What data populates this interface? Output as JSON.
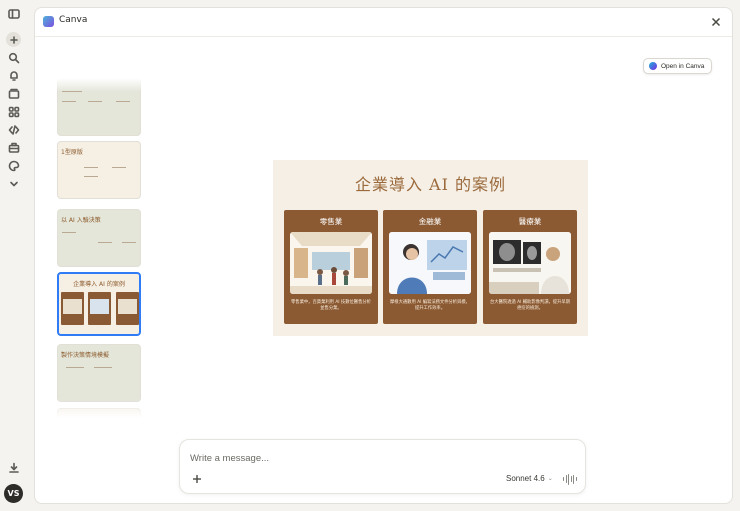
{
  "app": {
    "title": "Canva"
  },
  "rail": {
    "icons": [
      "sidebar-toggle-icon",
      "new-chat-icon",
      "search-icon",
      "notifications-icon",
      "projects-icon",
      "apps-icon",
      "code-icon",
      "briefcase-icon",
      "palette-icon",
      "chevron-down-icon",
      "download-icon"
    ],
    "avatar_initials": "VS"
  },
  "toolbar": {
    "open_in_canva_label": "Open in Canva"
  },
  "thumbnails": [
    {
      "title": ""
    },
    {
      "title": "1型原版"
    },
    {
      "title": "以 AI 入驗決策"
    },
    {
      "title": "企業導入 AI 的案例"
    },
    {
      "title": "製作決策情境模擬"
    },
    {
      "title": ""
    }
  ],
  "slide": {
    "title": "企業導入 AI 的案例",
    "cards": [
      {
        "title": "零售業",
        "text": "零售業中，百貨業利用 AI 技數位醫售分析並售分業。"
      },
      {
        "title": "金融業",
        "text": "摩根大通數用 AI 編寫法務文件分析與模，提升工作效率。"
      },
      {
        "title": "醫療業",
        "text": "台大醫院透過 AI 輔助影像判讀，提升早期癌症的檢測。"
      }
    ]
  },
  "composer": {
    "placeholder": "Write a message...",
    "model_label": "Sonnet 4.6"
  },
  "colors": {
    "accent": "#2f7cf6",
    "card_brown": "#8b5a33",
    "slide_bg": "#f6efe5",
    "title_brown": "#9a6a3c"
  }
}
